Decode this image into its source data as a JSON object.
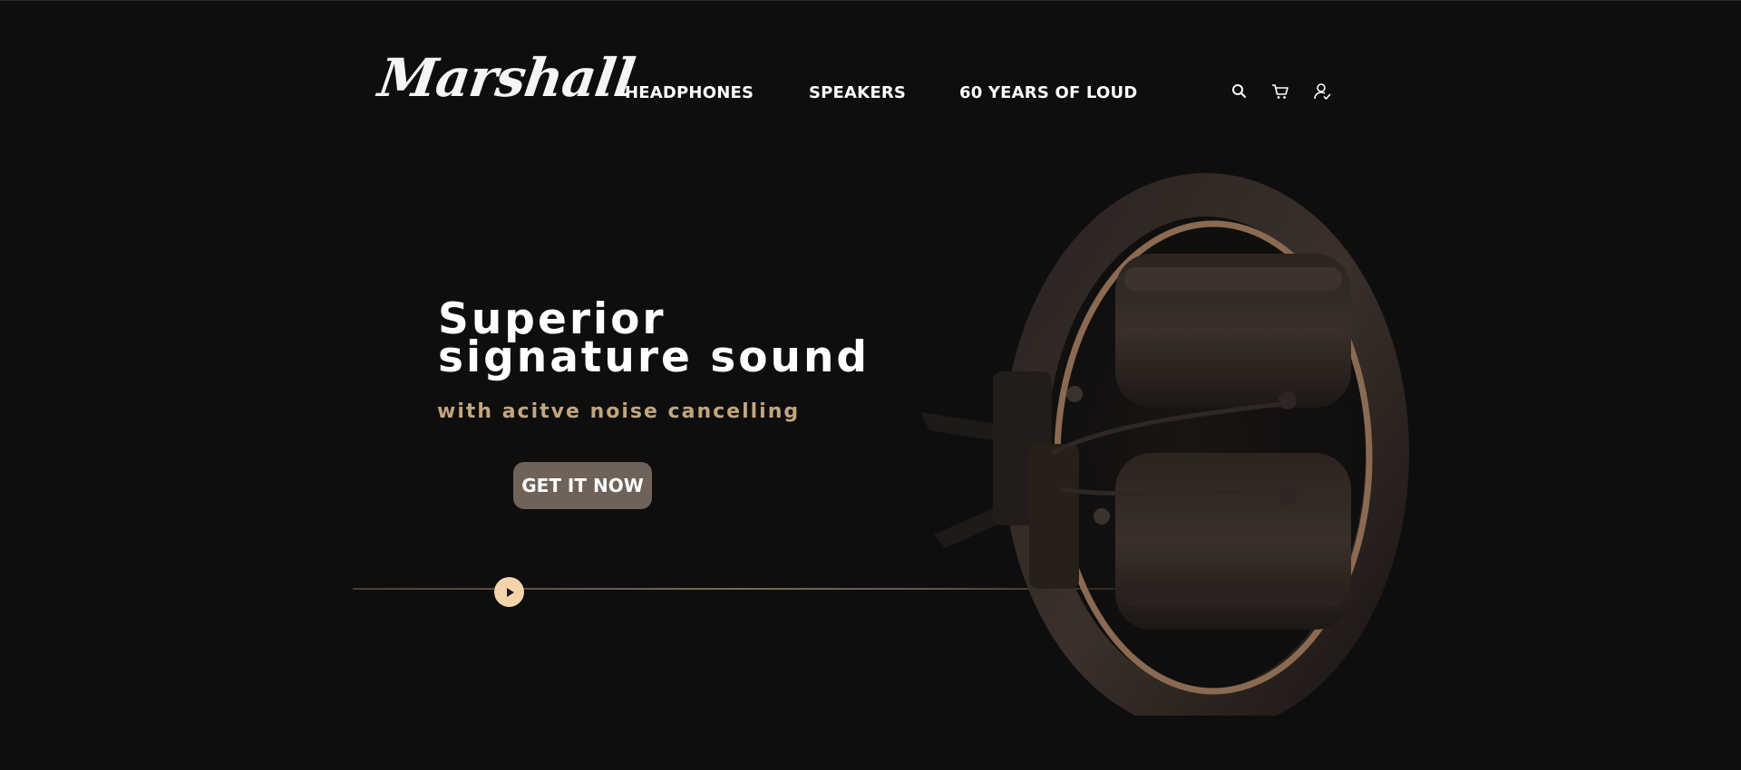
{
  "brand": {
    "logo_text": "Marshall"
  },
  "nav": {
    "items": [
      {
        "label": "HEADPHONES"
      },
      {
        "label": "SPEAKERS"
      },
      {
        "label": "60 YEARS OF LOUD"
      }
    ]
  },
  "header_icons": [
    "search-icon",
    "cart-icon",
    "user-icon"
  ],
  "hero": {
    "title_line1": "Superior",
    "title_line2": "signature sound",
    "subtitle": "with acitve noise cancelling",
    "cta_label": "GET IT NOW"
  },
  "colors": {
    "background": "#0e0e0e",
    "accent_gold": "#c2a680",
    "cta_bg": "#6e6259",
    "play_button": "#f5d3aa"
  }
}
